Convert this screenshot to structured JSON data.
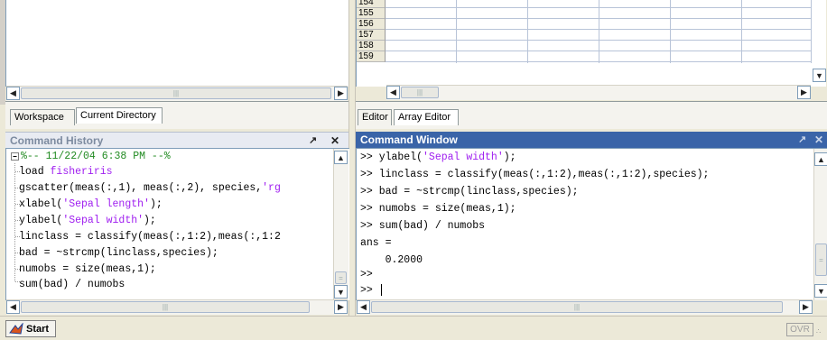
{
  "workspace_tabs": [
    {
      "label": "Workspace"
    },
    {
      "label": "Current Directory"
    }
  ],
  "editor_tabs": [
    {
      "label": "Editor"
    },
    {
      "label": "Array Editor"
    }
  ],
  "array_editor": {
    "row_numbers": [
      "154",
      "155",
      "156",
      "157",
      "158",
      "159"
    ]
  },
  "command_history": {
    "title": "Command History",
    "pin_glyph": "↗",
    "close_glyph": "✕",
    "session_header": "%-- 11/22/04  6:38 PM --%",
    "lines": [
      {
        "code": "load ",
        "str": "fisheriris"
      },
      {
        "code": "gscatter(meas(:,1), meas(:,2), species,",
        "str": "'rg"
      },
      {
        "code": "xlabel(",
        "str": "'Sepal length'",
        "tail": ");"
      },
      {
        "code": "ylabel(",
        "str": "'Sepal width'",
        "tail": ");"
      },
      {
        "code": "linclass = classify(meas(:,1:2),meas(:,1:2"
      },
      {
        "code": "bad = ~strcmp(linclass,species);"
      },
      {
        "code": "numobs = size(meas,1);"
      },
      {
        "code": "sum(bad) / numobs"
      }
    ]
  },
  "command_window": {
    "title": "Command Window",
    "lines": [
      {
        "code": ">> ylabel(",
        "str": "'Sepal width'",
        "tail": ");"
      },
      {
        "code": ">> linclass = classify(meas(:,1:2),meas(:,1:2),species);"
      },
      {
        "code": ">> bad = ~strcmp(linclass,species);"
      },
      {
        "code": ">> numobs = size(meas,1);"
      },
      {
        "code": ">> sum(bad) / numobs"
      },
      {
        "code": "ans ="
      },
      {
        "code": "    0.2000"
      },
      {
        "code": ""
      },
      {
        "code": ">>"
      },
      {
        "code": ">> "
      }
    ]
  },
  "statusbar": {
    "start_label": "Start",
    "ovr_label": "OVR"
  },
  "colors": {
    "string": "#a020f0",
    "history_title_bg": "#e8ebf2",
    "command_title_bg": "#3a64a8",
    "session_header": "#228b22"
  }
}
